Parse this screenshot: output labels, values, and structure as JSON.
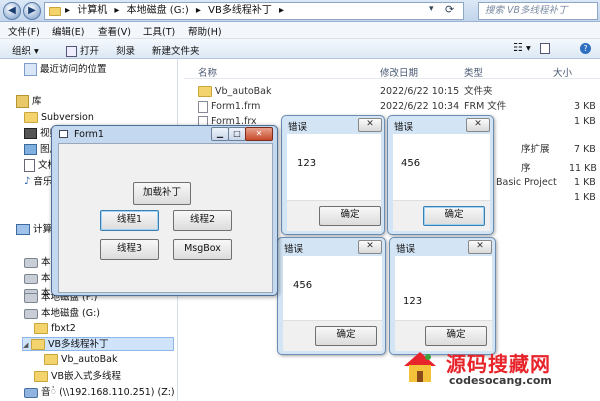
{
  "address": {
    "crumbs": [
      "计算机",
      "本地磁盘 (G:)",
      "VB多线程补丁"
    ],
    "search_placeholder": "搜索 VB多线程补丁"
  },
  "menu": [
    "文件(F)",
    "编辑(E)",
    "查看(V)",
    "工具(T)",
    "帮助(H)"
  ],
  "toolbar": {
    "organize": "组织",
    "open": "打开",
    "burn": "刻录",
    "new_folder": "新建文件夹"
  },
  "nav": {
    "recent": "最近访问的位置",
    "libraries": "库",
    "subversion": "Subversion",
    "video": "视频",
    "pictures": "图片",
    "docs": "文档",
    "music": "音乐",
    "computer": "计算机",
    "drive_a": "本",
    "drive_b": "本",
    "drive_c": "本",
    "drive_f": "本地磁盘 (F:)",
    "drive_g": "本地磁盘 (G:)",
    "fbxt2": "fbxt2",
    "vb_patch": "VB多线程补丁",
    "vb_autobak": "Vb_autoBak",
    "vb_embed": "VB嵌入式多线程",
    "net_drive": "音់ (\\\\192.168.110.251) (Z:)"
  },
  "columns": {
    "name": "名称",
    "date": "修改日期",
    "type": "类型",
    "size": "大小"
  },
  "files": [
    {
      "name": "Vb_autoBak",
      "date": "2022/6/22 10:15",
      "type": "文件夹",
      "size": ""
    },
    {
      "name": "Form1.frm",
      "date": "2022/6/22 10:34",
      "type": "FRM 文件",
      "size": "3 KB"
    },
    {
      "name": "Form1.frx",
      "date": "",
      "type": "",
      "size": "1 KB"
    },
    {
      "name": "",
      "date": "",
      "type": "序扩展",
      "size": "7 KB"
    },
    {
      "name": "",
      "date": "",
      "type": "序",
      "size": "11 KB"
    },
    {
      "name": "",
      "date": "",
      "type": "Basic Project",
      "size": "1 KB"
    },
    {
      "name": "",
      "date": "",
      "type": "",
      "size": "1 KB"
    }
  ],
  "form1": {
    "title": "Form1",
    "load_patch": "加载补丁",
    "thread1": "线程1",
    "thread2": "线程2",
    "thread3": "线程3",
    "msgbox": "MsgBox"
  },
  "dialogs": [
    {
      "title": "错误",
      "message": "123",
      "ok": "确定"
    },
    {
      "title": "错误",
      "message": "456",
      "ok": "确定"
    },
    {
      "title": "错误",
      "message": "456",
      "ok": "确定"
    },
    {
      "title": "错误",
      "message": "123",
      "ok": "确定"
    }
  ],
  "watermark": {
    "title": "源码搜藏网",
    "url": "codesocang.com"
  }
}
